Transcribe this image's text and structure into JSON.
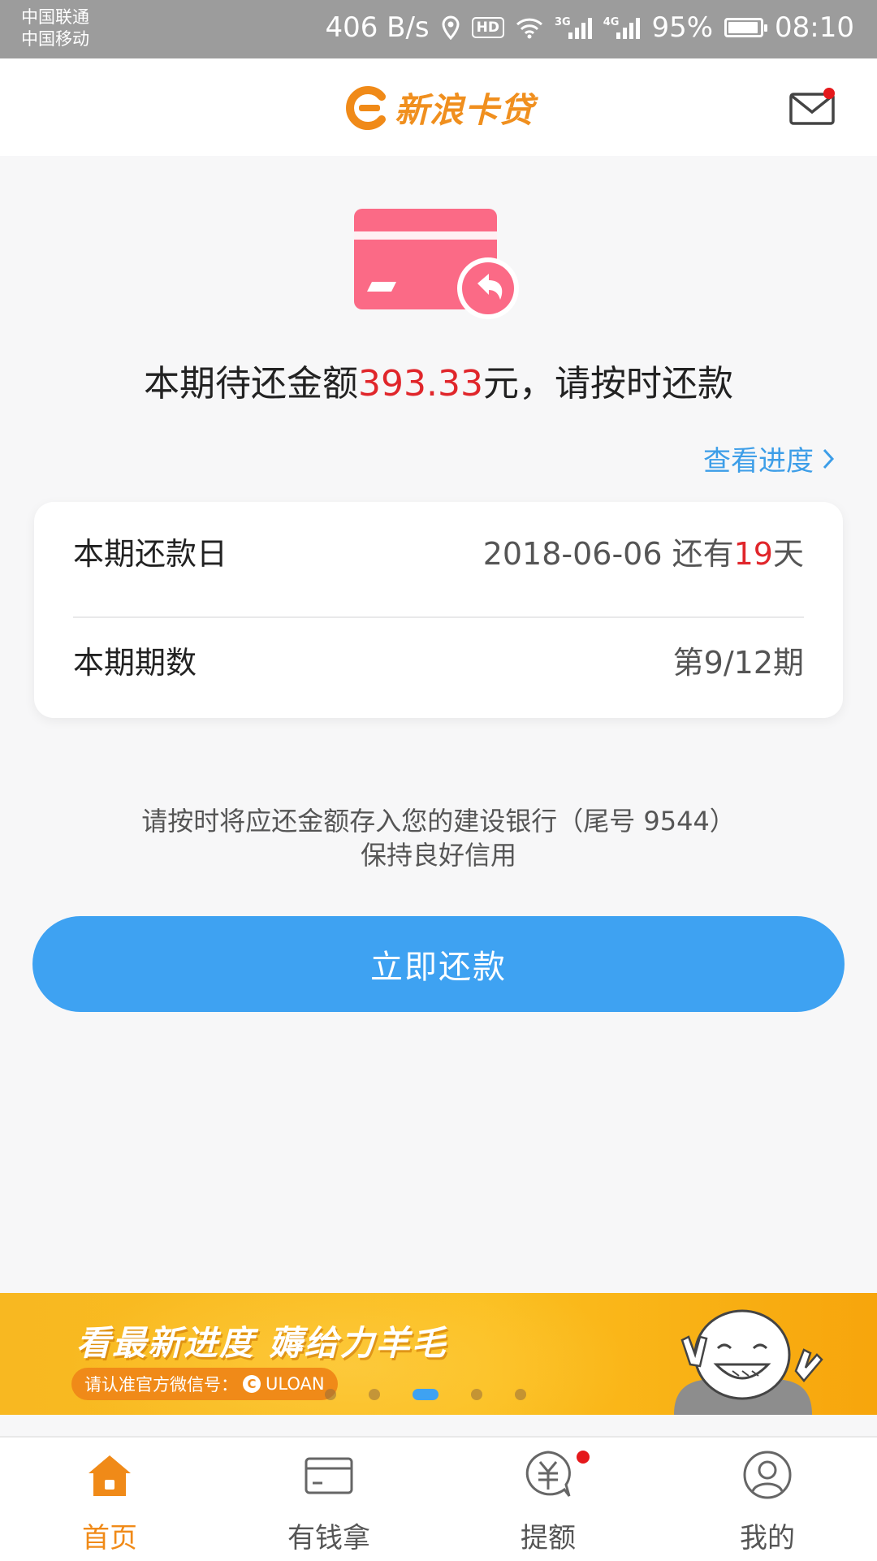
{
  "status_bar": {
    "carrier1": "中国联通",
    "carrier2": "中国移动",
    "net_speed": "406 B/s",
    "hd_badge": "HD",
    "net1_type": "3G",
    "net2_type": "4G",
    "battery": "95%",
    "battery_level": 0.95,
    "time": "08:10"
  },
  "header": {
    "logo_text": "新浪卡贷",
    "mail_has_notification": true
  },
  "summary": {
    "prefix": "本期待还金额",
    "amount": "393.33",
    "suffix": "元，请按时还款",
    "progress_link": "查看进度"
  },
  "info": {
    "rows": [
      {
        "label": "本期还款日",
        "date": "2018-06-06",
        "days_prefix": " 还有",
        "days": "19",
        "days_suffix": "天"
      },
      {
        "label": "本期期数",
        "value": "第9/12期"
      }
    ]
  },
  "notice": {
    "line1": "请按时将应还金额存入您的建设银行（尾号 9544）",
    "line2": "保持良好信用"
  },
  "pay_button": {
    "label": "立即还款"
  },
  "banner": {
    "title": "看最新进度 薅给力羊毛",
    "pill_text": "请认准官方微信号：",
    "pill_brand": "ULOAN",
    "slides": 5,
    "active_slide": 2
  },
  "tabs": [
    {
      "label": "首页",
      "icon": "home-icon",
      "active": true
    },
    {
      "label": "有钱拿",
      "icon": "card-icon",
      "active": false
    },
    {
      "label": "提额",
      "icon": "yuan-chat-icon",
      "active": false,
      "badge": true
    },
    {
      "label": "我的",
      "icon": "user-icon",
      "active": false
    }
  ],
  "colors": {
    "accent_blue": "#3ea2f2",
    "brand_orange": "#f08a18",
    "amount_red": "#e0262b",
    "card_pink": "#fb6a86"
  }
}
